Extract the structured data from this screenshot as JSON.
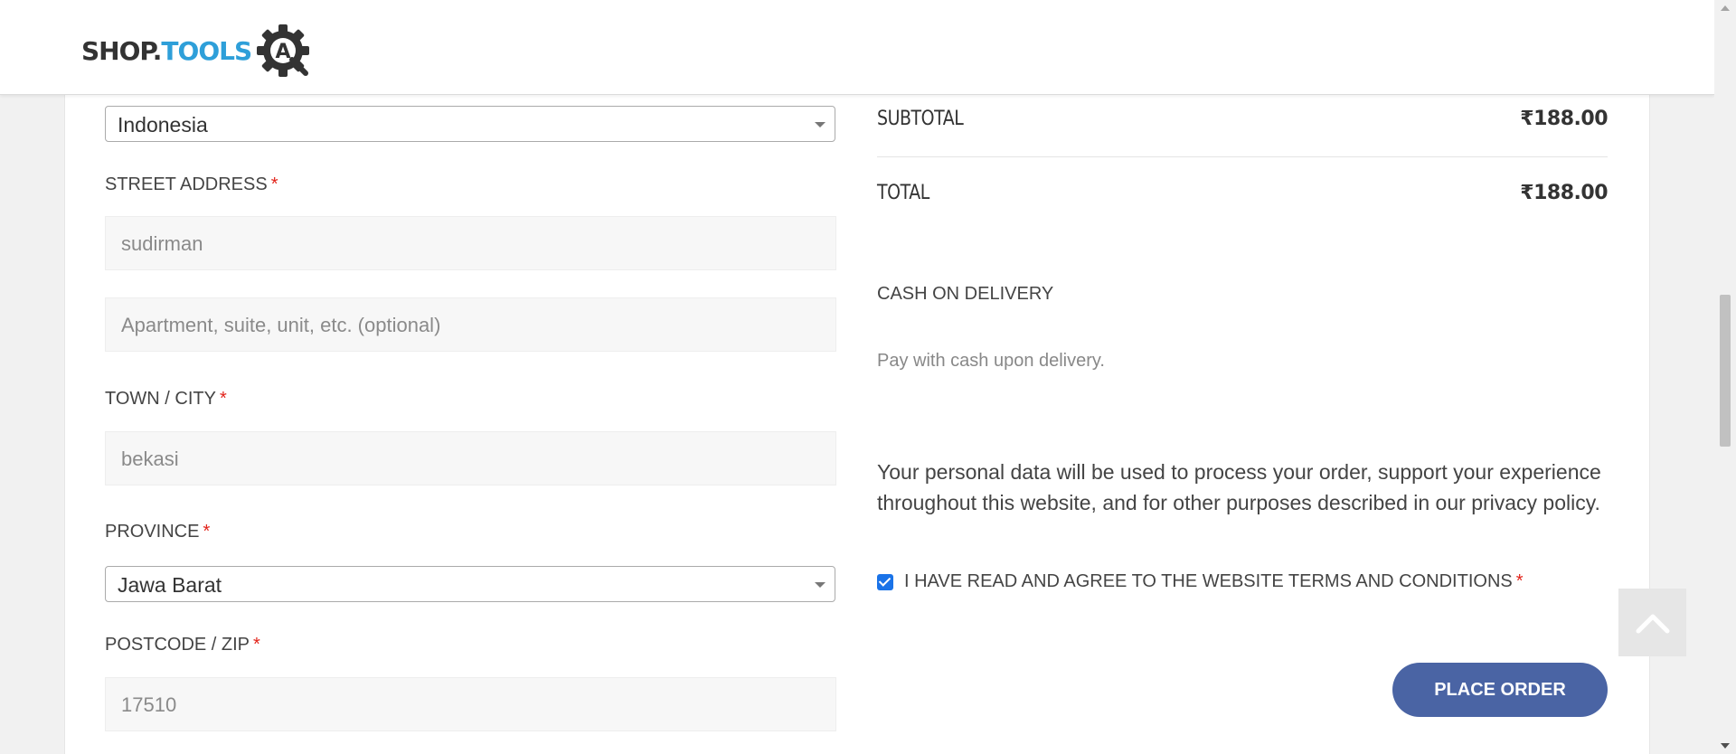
{
  "brand": {
    "logo_shop": "SHOP.",
    "logo_tools": "TOOLS",
    "logo_gear_letter": "A"
  },
  "form": {
    "country": {
      "value": "Indonesia"
    },
    "street": {
      "label": "STREET ADDRESS",
      "required_mark": "*",
      "value": "sudirman",
      "apartment_placeholder": "Apartment, suite, unit, etc. (optional)"
    },
    "city": {
      "label": "TOWN / CITY",
      "required_mark": "*",
      "value": "bekasi"
    },
    "province": {
      "label": "PROVINCE",
      "required_mark": "*",
      "value": "Jawa Barat"
    },
    "postcode": {
      "label": "POSTCODE / ZIP",
      "required_mark": "*",
      "value": "17510"
    }
  },
  "summary": {
    "subtotal_label": "SUBTOTAL",
    "subtotal_value": "₹188.00",
    "total_label": "TOTAL",
    "total_value": "₹188.00"
  },
  "payment": {
    "method": "CASH ON DELIVERY",
    "description": "Pay with cash upon delivery."
  },
  "privacy_text": "Your personal data will be used to process your order, support your experience throughout this website, and for other purposes described in our",
  "privacy_link": "privacy policy",
  "privacy_end": ".",
  "terms": {
    "label": "I HAVE READ AND AGREE TO THE WEBSITE TERMS AND CONDITIONS",
    "required_mark": "*",
    "checked": true
  },
  "place_order_label": "PLACE ORDER",
  "colors": {
    "accent_blue": "#4a64a4",
    "logo_blue": "#2e9fd9",
    "required_red": "#e2231a",
    "checkbox_blue": "#1a73e8"
  },
  "icons": {
    "scroll_top": "chevron-up-icon",
    "select_arrow": "caret-down-icon",
    "logo_mark": "gear-icon"
  }
}
